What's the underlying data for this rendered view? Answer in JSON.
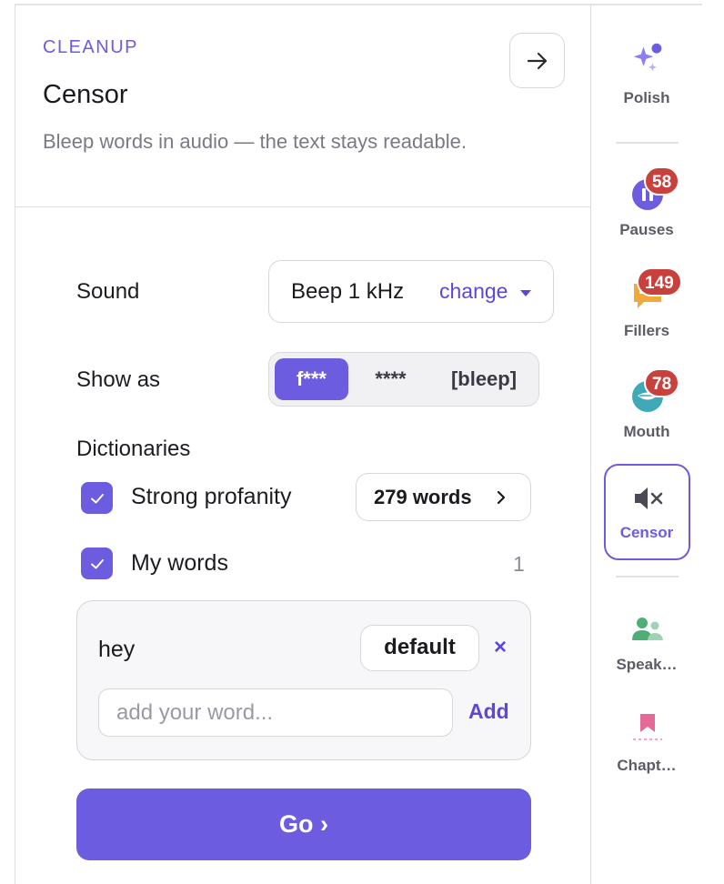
{
  "panel": {
    "eyebrow": "CLEANUP",
    "title": "Censor",
    "description": "Bleep words in audio — the text stays readable."
  },
  "sound": {
    "label": "Sound",
    "value": "Beep 1 kHz",
    "change_label": "change"
  },
  "show_as": {
    "label": "Show as",
    "options": [
      "f***",
      "****",
      "[bleep]"
    ],
    "selected": "f***"
  },
  "dictionaries": {
    "label": "Dictionaries",
    "items": [
      {
        "label": "Strong profanity",
        "checked": true,
        "button_label": "279 words"
      },
      {
        "label": "My words",
        "checked": true,
        "count": "1"
      }
    ],
    "custom_words": [
      {
        "word": "hey",
        "mode": "default",
        "remove": "×"
      }
    ],
    "input_placeholder": "add your word...",
    "add_label": "Add"
  },
  "go_label": "Go ›",
  "rail": {
    "items": [
      {
        "label": "Polish",
        "icon": "sparkle-icon"
      },
      {
        "label": "Pauses",
        "icon": "pause-icon",
        "badge": "58"
      },
      {
        "label": "Fillers",
        "icon": "speech-bubble-icon",
        "badge": "149"
      },
      {
        "label": "Mouth",
        "icon": "mouth-icon",
        "badge": "78"
      },
      {
        "label": "Censor",
        "icon": "mute-icon",
        "active": true
      },
      {
        "label": "Speak…",
        "icon": "speakers-icon"
      },
      {
        "label": "Chapt…",
        "icon": "bookmark-icon"
      }
    ]
  },
  "colors": {
    "accent": "#6b5ce0",
    "badge": "#c8413c"
  }
}
